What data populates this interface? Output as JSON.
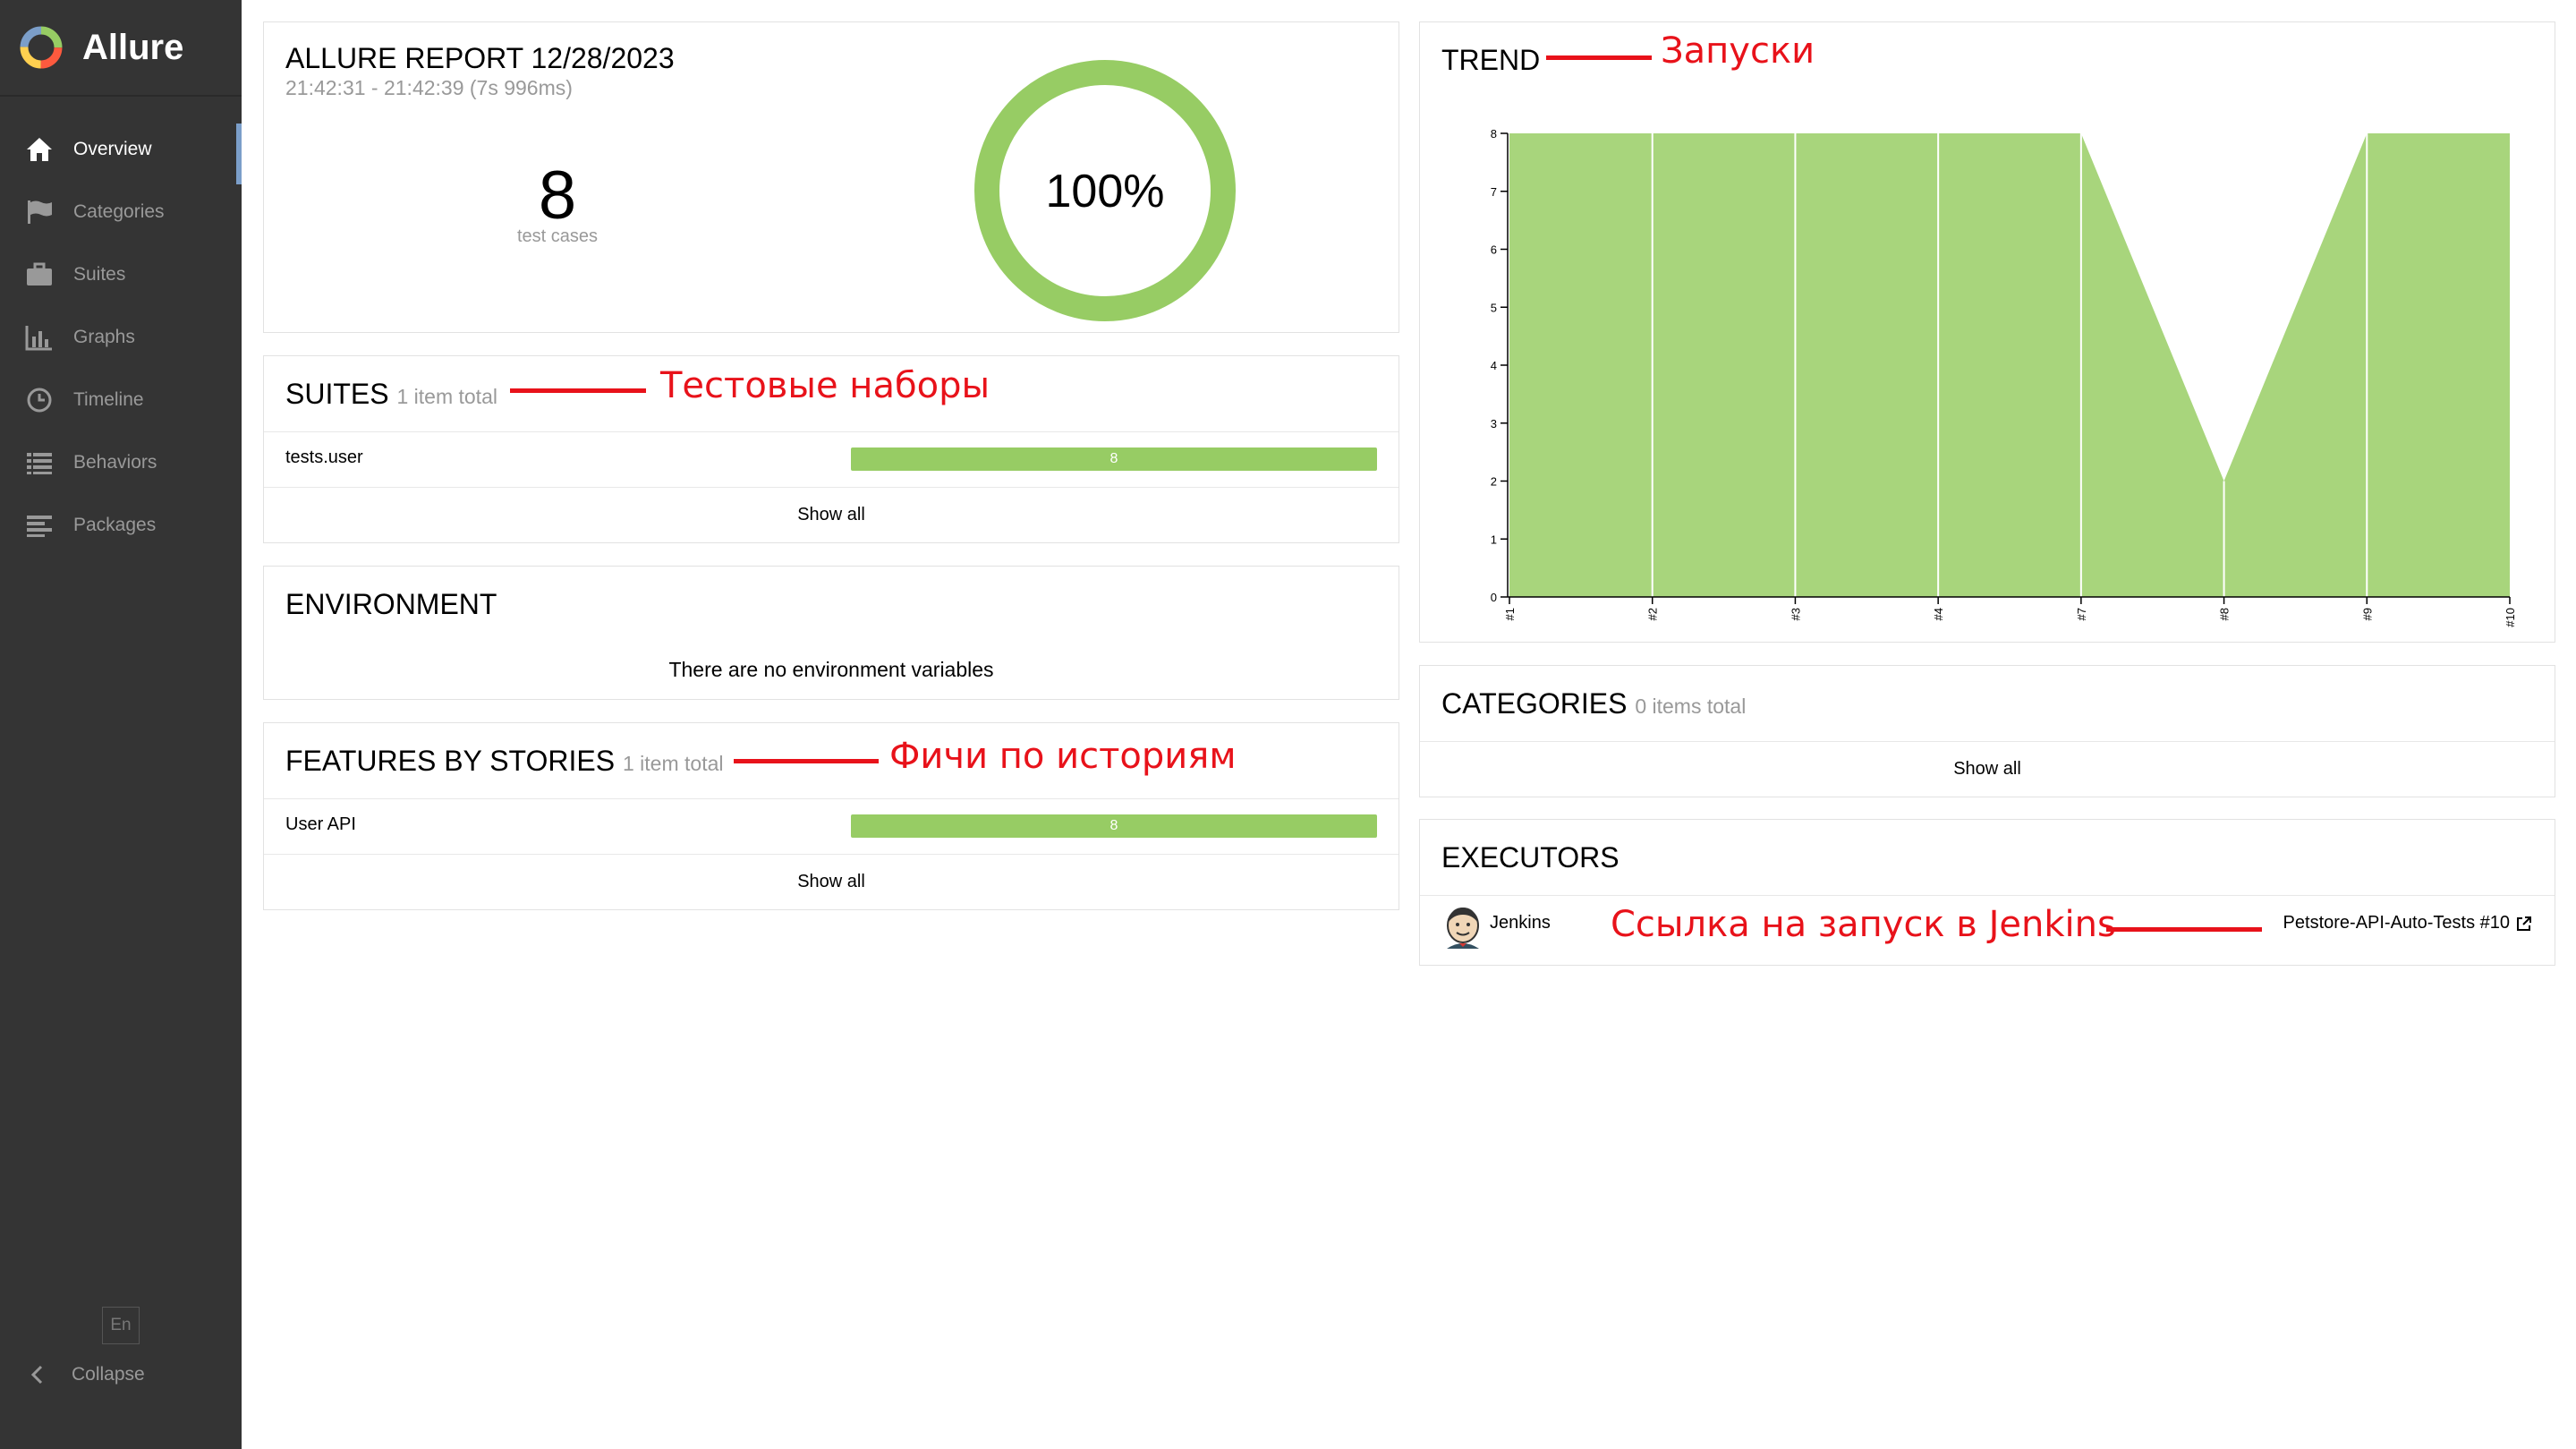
{
  "app": {
    "name": "Allure"
  },
  "sidebar": {
    "items": [
      {
        "label": "Overview",
        "icon": "home-icon",
        "active": true
      },
      {
        "label": "Categories",
        "icon": "flag-icon"
      },
      {
        "label": "Suites",
        "icon": "briefcase-icon"
      },
      {
        "label": "Graphs",
        "icon": "bar-chart-icon"
      },
      {
        "label": "Timeline",
        "icon": "clock-icon"
      },
      {
        "label": "Behaviors",
        "icon": "list-icon"
      },
      {
        "label": "Packages",
        "icon": "align-left-icon"
      }
    ],
    "language": "En",
    "collapse_label": "Collapse"
  },
  "summary": {
    "title": "ALLURE REPORT 12/28/2023",
    "time": "21:42:31 - 21:42:39 (7s 996ms)",
    "count": "8",
    "count_label": "test cases",
    "percent": "100%",
    "pass_fraction": 1.0
  },
  "suites": {
    "title": "SUITES",
    "subtitle": "1 item total",
    "rows": [
      {
        "name": "tests.user",
        "value": "8"
      }
    ],
    "show_all": "Show all"
  },
  "environment": {
    "title": "ENVIRONMENT",
    "empty_text": "There are no environment variables"
  },
  "features": {
    "title": "FEATURES BY STORIES",
    "subtitle": "1 item total",
    "rows": [
      {
        "name": "User API",
        "value": "8"
      }
    ],
    "show_all": "Show all"
  },
  "trend": {
    "title": "TREND"
  },
  "categories": {
    "title": "CATEGORIES",
    "subtitle": "0 items total",
    "show_all": "Show all"
  },
  "executors": {
    "title": "EXECUTORS",
    "name": "Jenkins",
    "link": "Petstore-API-Auto-Tests #10",
    "avatar_icon": "jenkins-icon",
    "link_icon": "external-link-icon"
  },
  "annotations": {
    "trend": "Запуски",
    "suites": "Тестовые наборы",
    "features": "Фичи по историям",
    "executors": "Ссылка на запуск в Jenkins"
  },
  "colors": {
    "passed": "#97cc64",
    "trend_fill": "#a8d57c",
    "sidebar": "#343434",
    "annotation": "#e8121a"
  },
  "chart_data": {
    "type": "area",
    "title": "TREND",
    "categories": [
      "#1",
      "#2",
      "#3",
      "#4",
      "#7",
      "#8",
      "#9",
      "#10"
    ],
    "series": [
      {
        "values": [
          8,
          8,
          8,
          8,
          8,
          2,
          8,
          8
        ]
      }
    ],
    "ylim": [
      0,
      8
    ],
    "yticks": [
      "0",
      "1",
      "2",
      "3",
      "4",
      "5",
      "6",
      "7",
      "8"
    ],
    "grid": false
  }
}
